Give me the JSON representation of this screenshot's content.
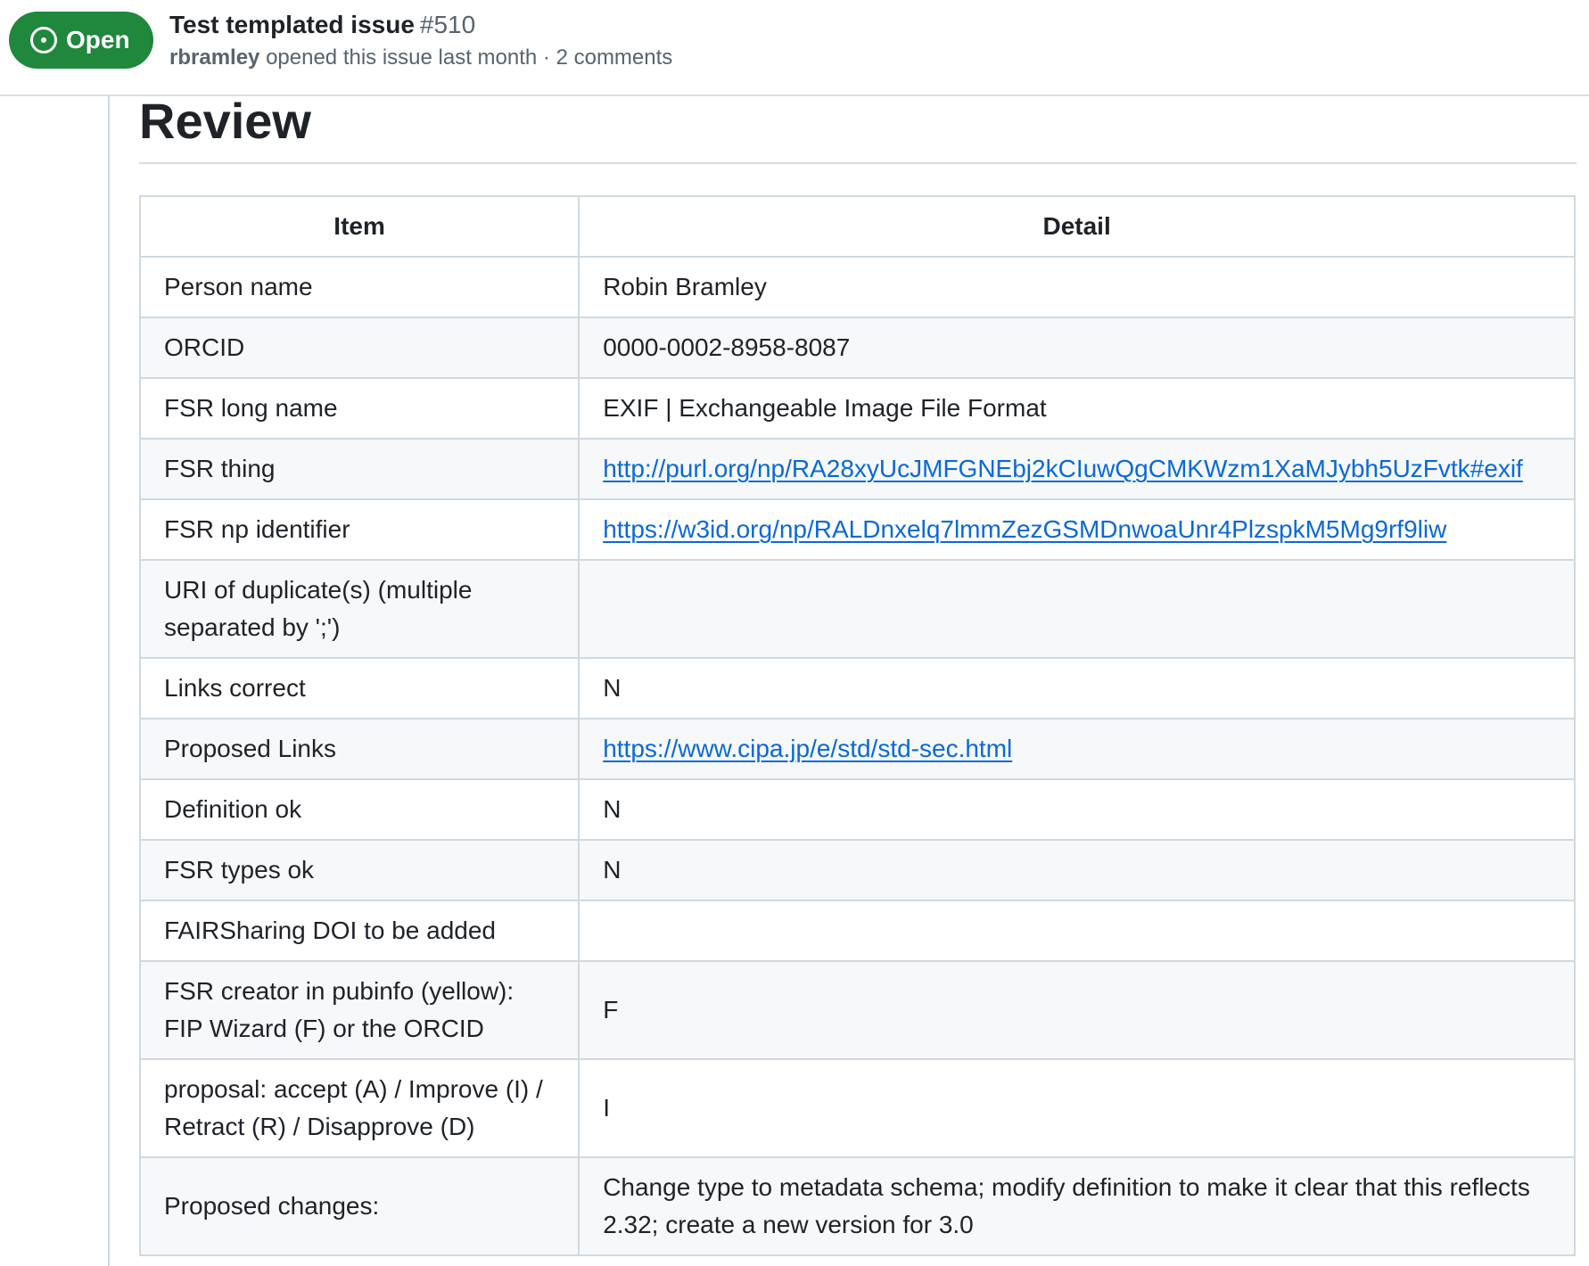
{
  "header": {
    "state_label": "Open",
    "state_color": "#1f883d",
    "title": "Test templated issue",
    "number": "#510",
    "author": "rbramley",
    "meta_text": "opened this issue last month · 2 comments"
  },
  "review": {
    "heading": "Review",
    "columns": [
      "Item",
      "Detail"
    ],
    "rows": [
      {
        "item": "Person name",
        "detail": "Robin Bramley"
      },
      {
        "item": "ORCID",
        "detail": "0000-0002-8958-8087"
      },
      {
        "item": "FSR long name",
        "detail": "EXIF | Exchangeable Image File Format"
      },
      {
        "item": "FSR thing",
        "detail": "http://purl.org/np/RA28xyUcJMFGNEbj2kCIuwQgCMKWzm1XaMJybh5UzFvtk#exif"
      },
      {
        "item": "FSR np identifier",
        "detail": "https://w3id.org/np/RALDnxelq7lmmZezGSMDnwoaUnr4PlzspkM5Mg9rf9liw"
      },
      {
        "item": "URI of duplicate(s) (multiple separated by ';')",
        "detail": ""
      },
      {
        "item": "Links correct",
        "detail": "N"
      },
      {
        "item": "Proposed Links",
        "detail": "https://www.cipa.jp/e/std/std-sec.html"
      },
      {
        "item": "Definition ok",
        "detail": "N"
      },
      {
        "item": "FSR types ok",
        "detail": "N"
      },
      {
        "item": "FAIRSharing DOI to be added",
        "detail": ""
      },
      {
        "item": "FSR creator in pubinfo (yellow): FIP Wizard (F) or the ORCID",
        "detail": "F"
      },
      {
        "item": "proposal: accept (A) / Improve (I) / Retract (R) / Disapprove (D)",
        "detail": "I"
      },
      {
        "item": "Proposed changes:",
        "detail": "Change type to metadata schema; modify definition to make it clear that this reflects 2.32; create a new version for 3.0"
      }
    ]
  },
  "colors": {
    "link": "#0969da",
    "open_badge": "#1f883d",
    "row_alt": "#f6f8fa",
    "border": "#d1d9e0"
  },
  "icons": {
    "state": "issue-opened-icon"
  }
}
